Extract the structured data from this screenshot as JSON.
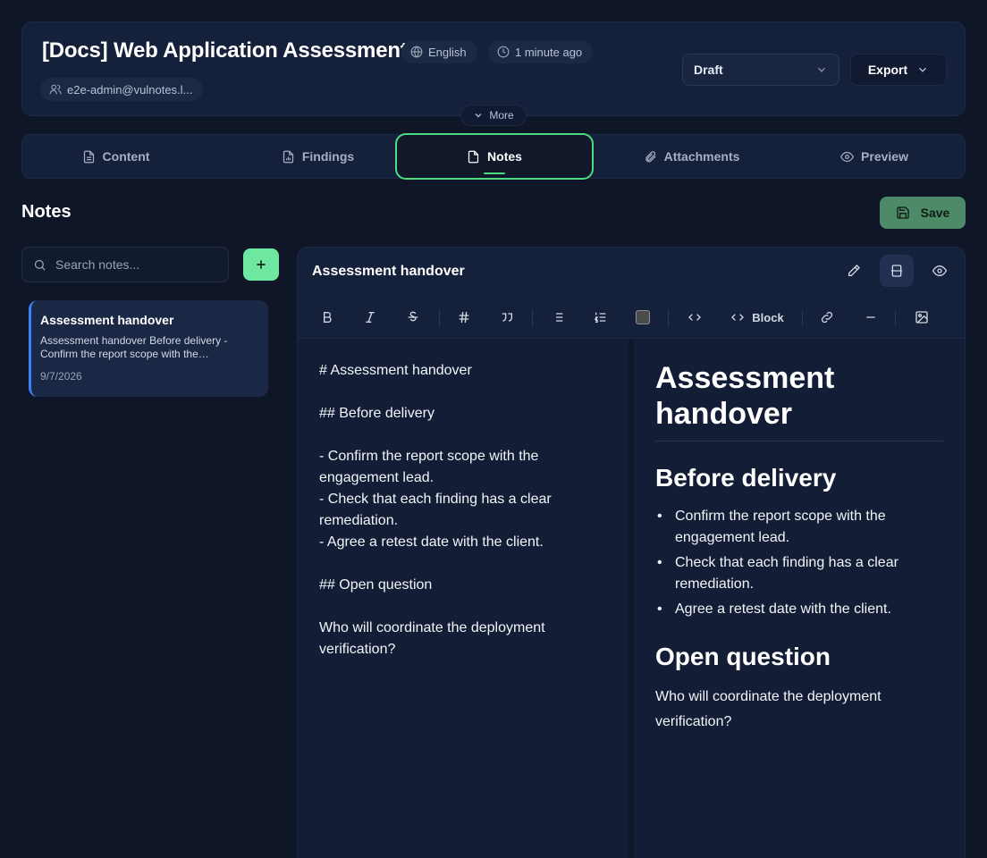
{
  "header": {
    "title": "[Docs] Web Application Assessment",
    "language": "English",
    "updated": "1 minute ago",
    "user": "e2e-admin@vulnotes.l...",
    "status_value": "Draft",
    "export_label": "Export",
    "more_label": "More"
  },
  "tabs": [
    {
      "label": "Content",
      "icon": "document-icon"
    },
    {
      "label": "Findings",
      "icon": "file-chart-icon"
    },
    {
      "label": "Notes",
      "icon": "note-icon",
      "active": true
    },
    {
      "label": "Attachments",
      "icon": "paperclip-icon"
    },
    {
      "label": "Preview",
      "icon": "eye-icon"
    }
  ],
  "notes_page": {
    "title": "Notes",
    "save_label": "Save",
    "search_placeholder": "Search notes..."
  },
  "notes_list": [
    {
      "title": "Assessment handover",
      "snippet": "Assessment handover Before delivery - Confirm the report scope with the engagement lead.",
      "date": "9/7/2026",
      "selected": true
    }
  ],
  "editor": {
    "title": "Assessment handover",
    "mode": "split",
    "toolbar": {
      "block_label": "Block"
    },
    "source": "# Assessment handover\n\n## Before delivery\n\n- Confirm the report scope with the engagement lead.\n- Check that each finding has a clear remediation.\n- Agree a retest date with the client.\n\n## Open question\n\nWho will coordinate the deployment verification?",
    "preview": {
      "h1": "Assessment handover",
      "h2_a": "Before delivery",
      "items": [
        "Confirm the report scope with the engagement lead.",
        "Check that each finding has a clear remediation.",
        "Agree a retest date with the client."
      ],
      "h2_b": "Open question",
      "paragraph": "Who will coordinate the deployment verification?"
    }
  },
  "colors": {
    "background": "#0f1628",
    "accent_green": "#4ade80",
    "save_button": "#4c8a68",
    "add_button": "#6ee7a0",
    "selected_note_bar": "#3b82f6"
  }
}
